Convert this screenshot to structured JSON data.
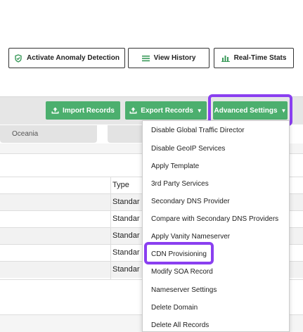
{
  "top_actions": {
    "anomaly_label": "Activate Anomaly Detection",
    "history_label": "View History",
    "stats_label": "Real-Time Stats"
  },
  "toolbar": {
    "import_label": "Import Records",
    "export_label": "Export Records",
    "advanced_label": "Advanced Settings"
  },
  "tabs": {
    "oceania_label": "Oceania"
  },
  "table": {
    "type_header": "Type",
    "rows": [
      {
        "type": "Standar"
      },
      {
        "type": "Standar"
      },
      {
        "type": "Standar"
      },
      {
        "type": "Standar"
      },
      {
        "type": "Standar"
      }
    ]
  },
  "dropdown": {
    "items": [
      "Disable Global Traffic Director",
      "Disable GeoIP Services",
      "Apply Template",
      "3rd Party Services",
      "Secondary DNS Provider",
      "Compare with Secondary DNS Providers",
      "Apply Vanity Nameserver",
      "CDN Provisioning",
      "Modify SOA Record",
      "Nameserver Settings",
      "Delete Domain",
      "Delete All Records"
    ]
  },
  "colors": {
    "primary_green": "#4caf6e",
    "highlight_purple": "#8a3ff0"
  }
}
